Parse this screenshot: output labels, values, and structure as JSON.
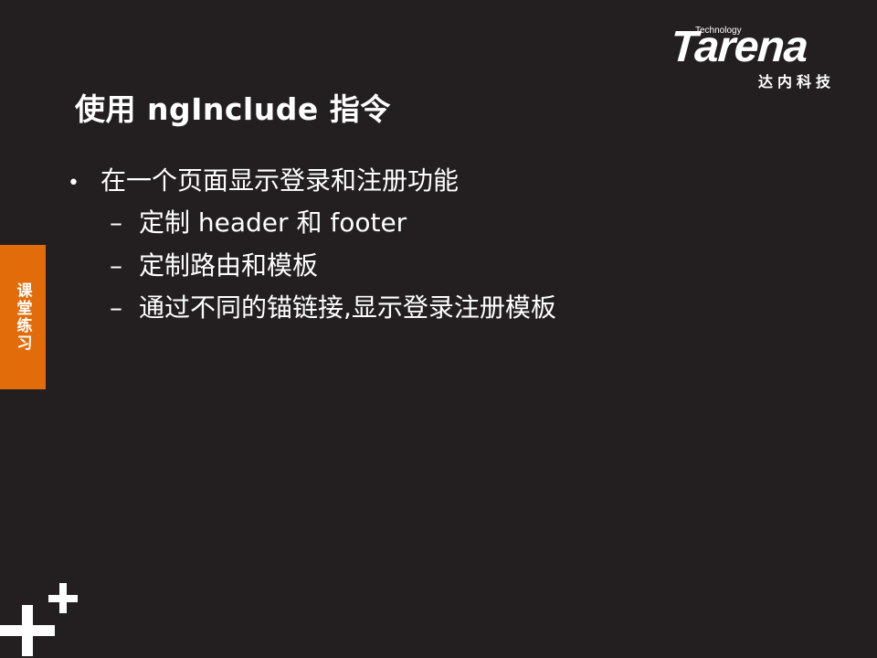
{
  "slide": {
    "title": "使用 ngInclude 指令",
    "logo": {
      "technology": "Technology",
      "brand": "Tarena",
      "chinese": "达内科技"
    },
    "side_tab": "课堂练习",
    "bullet": {
      "symbol": "•",
      "text": "在一个页面显示登录和注册功能"
    },
    "sub_items": [
      {
        "dash": "–",
        "text": "定制 header 和 footer"
      },
      {
        "dash": "–",
        "text": "定制路由和模板"
      },
      {
        "dash": "–",
        "text": "通过不同的锚链接,显示登录注册模板"
      }
    ],
    "colors": {
      "background": "#231f20",
      "accent": "#e36c0a",
      "text": "#ffffff"
    }
  }
}
